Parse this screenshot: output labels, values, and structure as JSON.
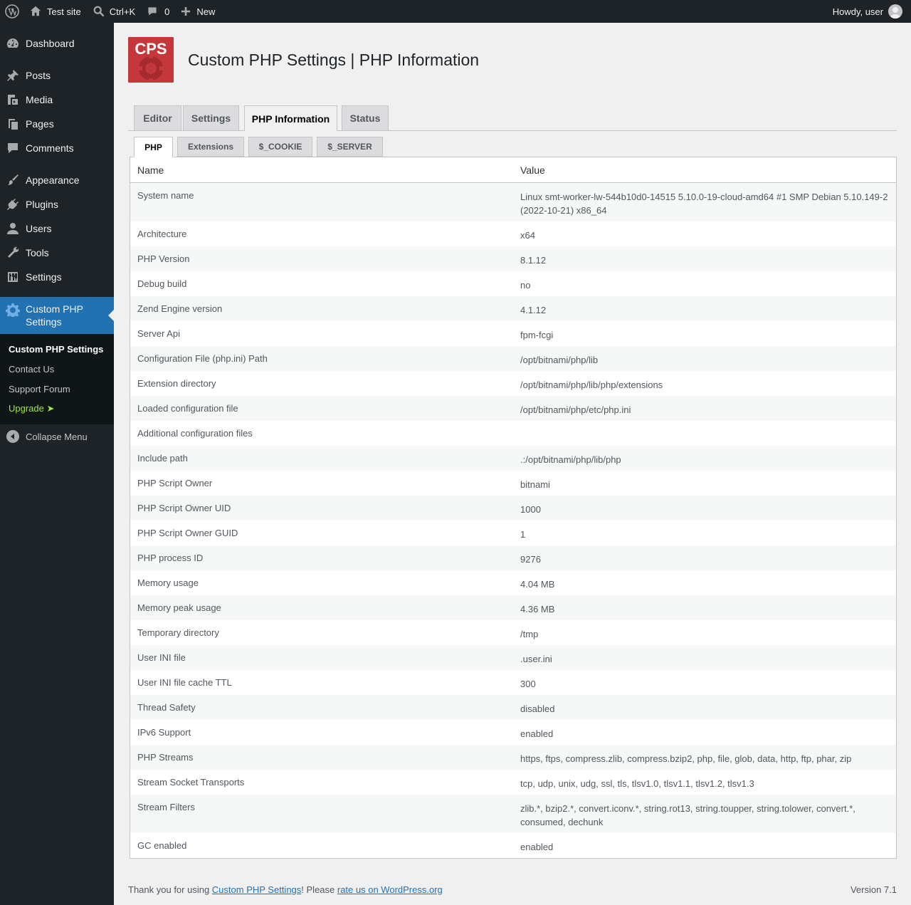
{
  "adminbar": {
    "site_name": "Test site",
    "search_shortcut": "Ctrl+K",
    "comments_count": "0",
    "new_label": "New",
    "howdy": "Howdy, user"
  },
  "sidebar": {
    "items": [
      {
        "label": "Dashboard",
        "icon": "dashboard-icon"
      },
      {
        "label": "Posts",
        "icon": "pin-icon"
      },
      {
        "label": "Media",
        "icon": "media-icon"
      },
      {
        "label": "Pages",
        "icon": "pages-icon"
      },
      {
        "label": "Comments",
        "icon": "comment-icon"
      },
      {
        "label": "Appearance",
        "icon": "brush-icon"
      },
      {
        "label": "Plugins",
        "icon": "plug-icon"
      },
      {
        "label": "Users",
        "icon": "user-icon"
      },
      {
        "label": "Tools",
        "icon": "wrench-icon"
      },
      {
        "label": "Settings",
        "icon": "sliders-icon"
      },
      {
        "label": "Custom PHP Settings",
        "icon": "gear-icon"
      }
    ],
    "submenu": [
      {
        "label": "Custom PHP Settings"
      },
      {
        "label": "Contact Us"
      },
      {
        "label": "Support Forum"
      },
      {
        "label": "Upgrade ➤"
      }
    ],
    "collapse_label": "Collapse Menu"
  },
  "page": {
    "logo_text": "CPS",
    "title": "Custom PHP Settings | PHP Information",
    "tabs": [
      "Editor",
      "Settings",
      "PHP Information",
      "Status"
    ],
    "active_tab": "PHP Information",
    "subtabs": [
      "PHP",
      "Extensions",
      "$_COOKIE",
      "$_SERVER"
    ],
    "active_subtab": "PHP"
  },
  "table": {
    "headers": [
      "Name",
      "Value"
    ],
    "rows": [
      {
        "name": "System name",
        "value": "Linux smt-worker-lw-544b10d0-14515 5.10.0-19-cloud-amd64 #1 SMP Debian 5.10.149-2 (2022-10-21) x86_64"
      },
      {
        "name": "Architecture",
        "value": "x64"
      },
      {
        "name": "PHP Version",
        "value": "8.1.12"
      },
      {
        "name": "Debug build",
        "value": "no"
      },
      {
        "name": "Zend Engine version",
        "value": "4.1.12"
      },
      {
        "name": "Server Api",
        "value": "fpm-fcgi"
      },
      {
        "name": "Configuration File (php.ini) Path",
        "value": "/opt/bitnami/php/lib"
      },
      {
        "name": "Extension directory",
        "value": "/opt/bitnami/php/lib/php/extensions"
      },
      {
        "name": "Loaded configuration file",
        "value": "/opt/bitnami/php/etc/php.ini"
      },
      {
        "name": "Additional configuration files",
        "value": ""
      },
      {
        "name": "Include path",
        "value": ".:/opt/bitnami/php/lib/php"
      },
      {
        "name": "PHP Script Owner",
        "value": "bitnami"
      },
      {
        "name": "PHP Script Owner UID",
        "value": "1000"
      },
      {
        "name": "PHP Script Owner GUID",
        "value": "1"
      },
      {
        "name": "PHP process ID",
        "value": "9276"
      },
      {
        "name": "Memory usage",
        "value": "4.04 MB"
      },
      {
        "name": "Memory peak usage",
        "value": "4.36 MB"
      },
      {
        "name": "Temporary directory",
        "value": "/tmp"
      },
      {
        "name": "User INI file",
        "value": ".user.ini"
      },
      {
        "name": "User INI file cache TTL",
        "value": "300"
      },
      {
        "name": "Thread Safety",
        "value": "disabled"
      },
      {
        "name": "IPv6 Support",
        "value": "enabled"
      },
      {
        "name": "PHP Streams",
        "value": "https, ftps, compress.zlib, compress.bzip2, php, file, glob, data, http, ftp, phar, zip"
      },
      {
        "name": "Stream Socket Transports",
        "value": "tcp, udp, unix, udg, ssl, tls, tlsv1.0, tlsv1.1, tlsv1.2, tlsv1.3"
      },
      {
        "name": "Stream Filters",
        "value": "zlib.*, bzip2.*, convert.iconv.*, string.rot13, string.toupper, string.tolower, convert.*, consumed, dechunk"
      },
      {
        "name": "GC enabled",
        "value": "enabled"
      }
    ]
  },
  "footer": {
    "prefix": "Thank you for using ",
    "link1": "Custom PHP Settings",
    "middle": "! Please ",
    "link2": "rate us on WordPress.org",
    "version": "Version 7.1"
  }
}
